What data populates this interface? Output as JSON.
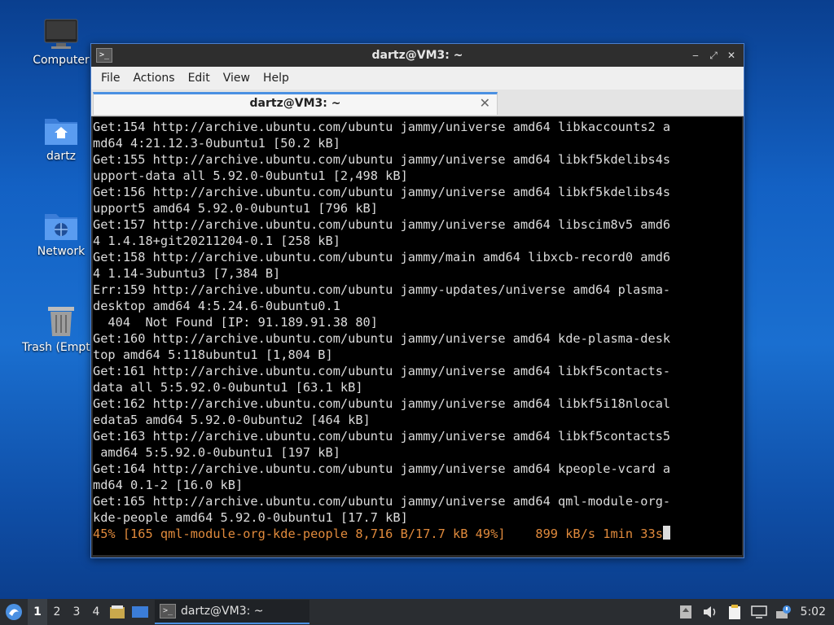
{
  "desktop": {
    "icons": [
      {
        "label": "Computer",
        "icon": "monitor-icon"
      },
      {
        "label": "dartz",
        "icon": "home-folder-icon"
      },
      {
        "label": "Network",
        "icon": "network-folder-icon"
      },
      {
        "label": "Trash (Empty)",
        "icon": "trash-icon"
      }
    ]
  },
  "window": {
    "title": "dartz@VM3: ~",
    "controls": {
      "minimize": "‒",
      "maximize": "⤢",
      "close": "✕"
    },
    "menu": [
      "File",
      "Actions",
      "Edit",
      "View",
      "Help"
    ],
    "tab": {
      "label": "dartz@VM3: ~",
      "close": "✕"
    }
  },
  "terminal": {
    "lines": [
      "Get:154 http://archive.ubuntu.com/ubuntu jammy/universe amd64 libkaccounts2 a",
      "md64 4:21.12.3-0ubuntu1 [50.2 kB]",
      "Get:155 http://archive.ubuntu.com/ubuntu jammy/universe amd64 libkf5kdelibs4s",
      "upport-data all 5.92.0-0ubuntu1 [2,498 kB]",
      "Get:156 http://archive.ubuntu.com/ubuntu jammy/universe amd64 libkf5kdelibs4s",
      "upport5 amd64 5.92.0-0ubuntu1 [796 kB]",
      "Get:157 http://archive.ubuntu.com/ubuntu jammy/universe amd64 libscim8v5 amd6",
      "4 1.4.18+git20211204-0.1 [258 kB]",
      "Get:158 http://archive.ubuntu.com/ubuntu jammy/main amd64 libxcb-record0 amd6",
      "4 1.14-3ubuntu3 [7,384 B]",
      "Err:159 http://archive.ubuntu.com/ubuntu jammy-updates/universe amd64 plasma-",
      "desktop amd64 4:5.24.6-0ubuntu0.1",
      "  404  Not Found [IP: 91.189.91.38 80]",
      "Get:160 http://archive.ubuntu.com/ubuntu jammy/universe amd64 kde-plasma-desk",
      "top amd64 5:118ubuntu1 [1,804 B]",
      "Get:161 http://archive.ubuntu.com/ubuntu jammy/universe amd64 libkf5contacts-",
      "data all 5:5.92.0-0ubuntu1 [63.1 kB]",
      "Get:162 http://archive.ubuntu.com/ubuntu jammy/universe amd64 libkf5i18nlocal",
      "edata5 amd64 5.92.0-0ubuntu2 [464 kB]",
      "Get:163 http://archive.ubuntu.com/ubuntu jammy/universe amd64 libkf5contacts5",
      " amd64 5:5.92.0-0ubuntu1 [197 kB]",
      "Get:164 http://archive.ubuntu.com/ubuntu jammy/universe amd64 kpeople-vcard a",
      "md64 0.1-2 [16.0 kB]",
      "Get:165 http://archive.ubuntu.com/ubuntu jammy/universe amd64 qml-module-org-",
      "kde-people amd64 5.92.0-0ubuntu1 [17.7 kB]"
    ],
    "progress_line": "45% [165 qml-module-org-kde-people 8,716 B/17.7 kB 49%]    899 kB/s 1min 33s",
    "progress_color": "#e08a3c"
  },
  "taskbar": {
    "workspaces": [
      "1",
      "2",
      "3",
      "4"
    ],
    "active_workspace": "1",
    "task": {
      "label": "dartz@VM3: ~"
    },
    "clock": "5:02"
  },
  "colors": {
    "accent": "#4a90e2"
  }
}
